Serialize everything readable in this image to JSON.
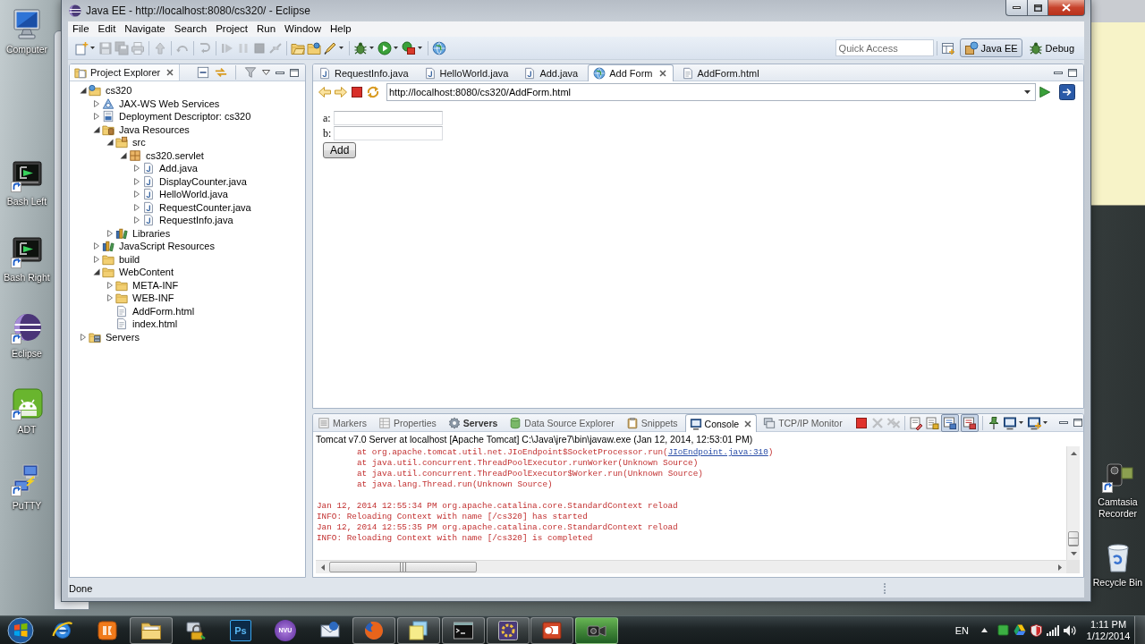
{
  "desktop": {
    "icons_left": [
      {
        "label": "Computer",
        "kind": "computer",
        "shortcut": false
      },
      {
        "label": "Bash Left",
        "kind": "console",
        "shortcut": true
      },
      {
        "label": "Bash Right",
        "kind": "console",
        "shortcut": true
      },
      {
        "label": "Eclipse",
        "kind": "sphere",
        "shortcut": true
      },
      {
        "label": "ADT",
        "kind": "robot",
        "shortcut": true
      },
      {
        "label": "PuTTY",
        "kind": "network",
        "shortcut": true
      }
    ],
    "icons_right": [
      {
        "label": "Camtasia Recorder",
        "kind": "camera",
        "shortcut": true
      },
      {
        "label": "Recycle Bin",
        "kind": "trash",
        "shortcut": false
      }
    ]
  },
  "window": {
    "title": "Java EE - http://localhost:8080/cs320/ - Eclipse"
  },
  "menu": [
    "File",
    "Edit",
    "Navigate",
    "Search",
    "Project",
    "Run",
    "Window",
    "Help"
  ],
  "toolbar": {
    "items": [
      {
        "kind": "new",
        "disabled": false,
        "dropdown": true
      },
      {
        "kind": "save",
        "disabled": true
      },
      {
        "kind": "save-all",
        "disabled": true
      },
      {
        "kind": "print",
        "disabled": true
      },
      {
        "kind": "separator"
      },
      {
        "kind": "step-up",
        "disabled": true
      },
      {
        "kind": "separator"
      },
      {
        "kind": "undo-arrow",
        "disabled": true
      },
      {
        "kind": "separator"
      },
      {
        "kind": "redo-arrow",
        "disabled": true
      },
      {
        "kind": "separator"
      },
      {
        "kind": "resume",
        "disabled": true
      },
      {
        "kind": "pause",
        "disabled": true
      },
      {
        "kind": "stop",
        "disabled": true
      },
      {
        "kind": "disconnect",
        "disabled": true
      },
      {
        "kind": "separator"
      },
      {
        "kind": "open-type",
        "disabled": false
      },
      {
        "kind": "open-task",
        "disabled": false
      },
      {
        "kind": "brush",
        "disabled": false,
        "dropdown": true
      },
      {
        "kind": "separator"
      },
      {
        "kind": "bug",
        "disabled": false,
        "dropdown": true
      },
      {
        "kind": "run",
        "disabled": false,
        "dropdown": true
      },
      {
        "kind": "tools",
        "disabled": false,
        "dropdown": true
      },
      {
        "kind": "separator"
      },
      {
        "kind": "globe",
        "disabled": false
      }
    ],
    "quick_access": {
      "placeholder": "Quick Access"
    },
    "perspectives": [
      {
        "label": "Java EE",
        "kind": "javaee",
        "selected": true
      },
      {
        "label": "Debug",
        "kind": "debug",
        "selected": false
      }
    ]
  },
  "project_explorer": {
    "title": "Project Explorer",
    "tree": [
      {
        "label": "cs320",
        "kind": "project",
        "expanded": true,
        "children": [
          {
            "label": "JAX-WS Web Services",
            "kind": "services",
            "expanded": false
          },
          {
            "label": "Deployment Descriptor: cs320",
            "kind": "descriptor",
            "expanded": false
          },
          {
            "label": "Java Resources",
            "kind": "java-resources",
            "expanded": true,
            "children": [
              {
                "label": "src",
                "kind": "source",
                "expanded": true,
                "children": [
                  {
                    "label": "cs320.servlet",
                    "kind": "package",
                    "expanded": true,
                    "children": [
                      {
                        "label": "Add.java",
                        "kind": "java",
                        "expanded": false
                      },
                      {
                        "label": "DisplayCounter.java",
                        "kind": "java",
                        "expanded": false
                      },
                      {
                        "label": "HelloWorld.java",
                        "kind": "java",
                        "expanded": false
                      },
                      {
                        "label": "RequestCounter.java",
                        "kind": "java",
                        "expanded": false
                      },
                      {
                        "label": "RequestInfo.java",
                        "kind": "java",
                        "expanded": false
                      }
                    ]
                  }
                ]
              },
              {
                "label": "Libraries",
                "kind": "libraries",
                "expanded": false
              }
            ]
          },
          {
            "label": "JavaScript Resources",
            "kind": "libraries",
            "expanded": false
          },
          {
            "label": "build",
            "kind": "folder",
            "expanded": false
          },
          {
            "label": "WebContent",
            "kind": "folder",
            "expanded": true,
            "children": [
              {
                "label": "META-INF",
                "kind": "folder",
                "expanded": false
              },
              {
                "label": "WEB-INF",
                "kind": "folder",
                "expanded": false
              },
              {
                "label": "AddForm.html",
                "kind": "html"
              },
              {
                "label": "index.html",
                "kind": "html"
              }
            ]
          }
        ]
      },
      {
        "label": "Servers",
        "kind": "servers",
        "expanded": false
      }
    ]
  },
  "editor": {
    "tabs": [
      {
        "label": "RequestInfo.java",
        "kind": "java",
        "selected": false
      },
      {
        "label": "HelloWorld.java",
        "kind": "java",
        "selected": false
      },
      {
        "label": "Add.java",
        "kind": "java",
        "selected": false
      },
      {
        "label": "Add Form",
        "kind": "browser",
        "selected": true
      },
      {
        "label": "AddForm.html",
        "kind": "html",
        "selected": false
      }
    ],
    "browser": {
      "url": "http://localhost:8080/cs320/AddForm.html",
      "form": {
        "fields": [
          {
            "label": "a:"
          },
          {
            "label": "b:"
          }
        ],
        "button": "Add"
      }
    }
  },
  "bottom_panel": {
    "tabs": [
      {
        "label": "Markers",
        "kind": "markers",
        "selected": false,
        "emphasized": false
      },
      {
        "label": "Properties",
        "kind": "properties",
        "selected": false,
        "emphasized": false
      },
      {
        "label": "Servers",
        "kind": "servers",
        "selected": false,
        "emphasized": true
      },
      {
        "label": "Data Source Explorer",
        "kind": "datasource",
        "selected": false,
        "emphasized": false
      },
      {
        "label": "Snippets",
        "kind": "snippets",
        "selected": false,
        "emphasized": false
      },
      {
        "label": "Console",
        "kind": "console",
        "selected": true,
        "emphasized": false
      },
      {
        "label": "TCP/IP Monitor",
        "kind": "monitor",
        "selected": false,
        "emphasized": false
      }
    ],
    "toolbar": [
      {
        "kind": "terminate",
        "disabled": false,
        "pressed": false
      },
      {
        "kind": "remove",
        "disabled": true,
        "pressed": false
      },
      {
        "kind": "remove-all",
        "disabled": true,
        "pressed": false
      },
      {
        "kind": "separator"
      },
      {
        "kind": "clear",
        "disabled": false,
        "pressed": false
      },
      {
        "kind": "scroll-lock",
        "disabled": false,
        "pressed": false
      },
      {
        "kind": "stdout",
        "disabled": false,
        "pressed": true
      },
      {
        "kind": "stderr",
        "disabled": false,
        "pressed": true
      },
      {
        "kind": "separator"
      },
      {
        "kind": "pin",
        "disabled": false,
        "pressed": false
      },
      {
        "kind": "display",
        "disabled": false,
        "pressed": false,
        "dropdown": true
      },
      {
        "kind": "open-console",
        "disabled": false,
        "pressed": false,
        "dropdown": true
      }
    ],
    "console": {
      "description": "Tomcat v7.0 Server at localhost [Apache Tomcat] C:\\Java\\jre7\\bin\\javaw.exe (Jan 12, 2014, 12:53:01 PM)",
      "blocks": [
        [
          {
            "kind": "trace",
            "text": "at org.apache.tomcat.util.net.JIoEndpoint$SocketProcessor.run(",
            "link": "JIoEndpoint.java:310",
            "after": ")"
          },
          {
            "kind": "trace",
            "text": "at java.util.concurrent.ThreadPoolExecutor.runWorker(Unknown Source)"
          },
          {
            "kind": "trace",
            "text": "at java.util.concurrent.ThreadPoolExecutor$Worker.run(Unknown Source)"
          },
          {
            "kind": "trace",
            "text": "at java.lang.Thread.run(Unknown Source)"
          }
        ],
        [
          {
            "kind": "message",
            "text": "Jan 12, 2014 12:55:34 PM org.apache.catalina.core.StandardContext reload"
          },
          {
            "kind": "message",
            "text": "INFO: Reloading Context with name [/cs320] has started"
          },
          {
            "kind": "message",
            "text": "Jan 12, 2014 12:55:35 PM org.apache.catalina.core.StandardContext reload"
          },
          {
            "kind": "message",
            "text": "INFO: Reloading Context with name [/cs320] is completed"
          }
        ]
      ]
    }
  },
  "status_bar": {
    "text": "Done"
  },
  "taskbar": {
    "items": [
      {
        "kind": "browser-e",
        "running": false,
        "active": false
      },
      {
        "kind": "app-tile",
        "running": false,
        "active": false
      },
      {
        "kind": "folder",
        "running": true,
        "active": false
      },
      {
        "kind": "padlock",
        "running": false,
        "active": false
      },
      {
        "kind": "letter-tile",
        "label": "Ps",
        "running": false,
        "active": false
      },
      {
        "kind": "letter-disc",
        "label": "NVU",
        "running": false,
        "active": false
      },
      {
        "kind": "mail",
        "running": false,
        "active": false
      },
      {
        "kind": "fox",
        "running": true,
        "active": false
      },
      {
        "kind": "notes",
        "running": true,
        "active": false
      },
      {
        "kind": "terminal",
        "running": true,
        "active": false
      },
      {
        "kind": "ide",
        "running": true,
        "active": false
      },
      {
        "kind": "slides",
        "running": true,
        "active": false
      },
      {
        "kind": "camera",
        "running": true,
        "active": true
      }
    ],
    "language": "EN",
    "time": "1:11 PM",
    "date": "1/12/2014"
  }
}
